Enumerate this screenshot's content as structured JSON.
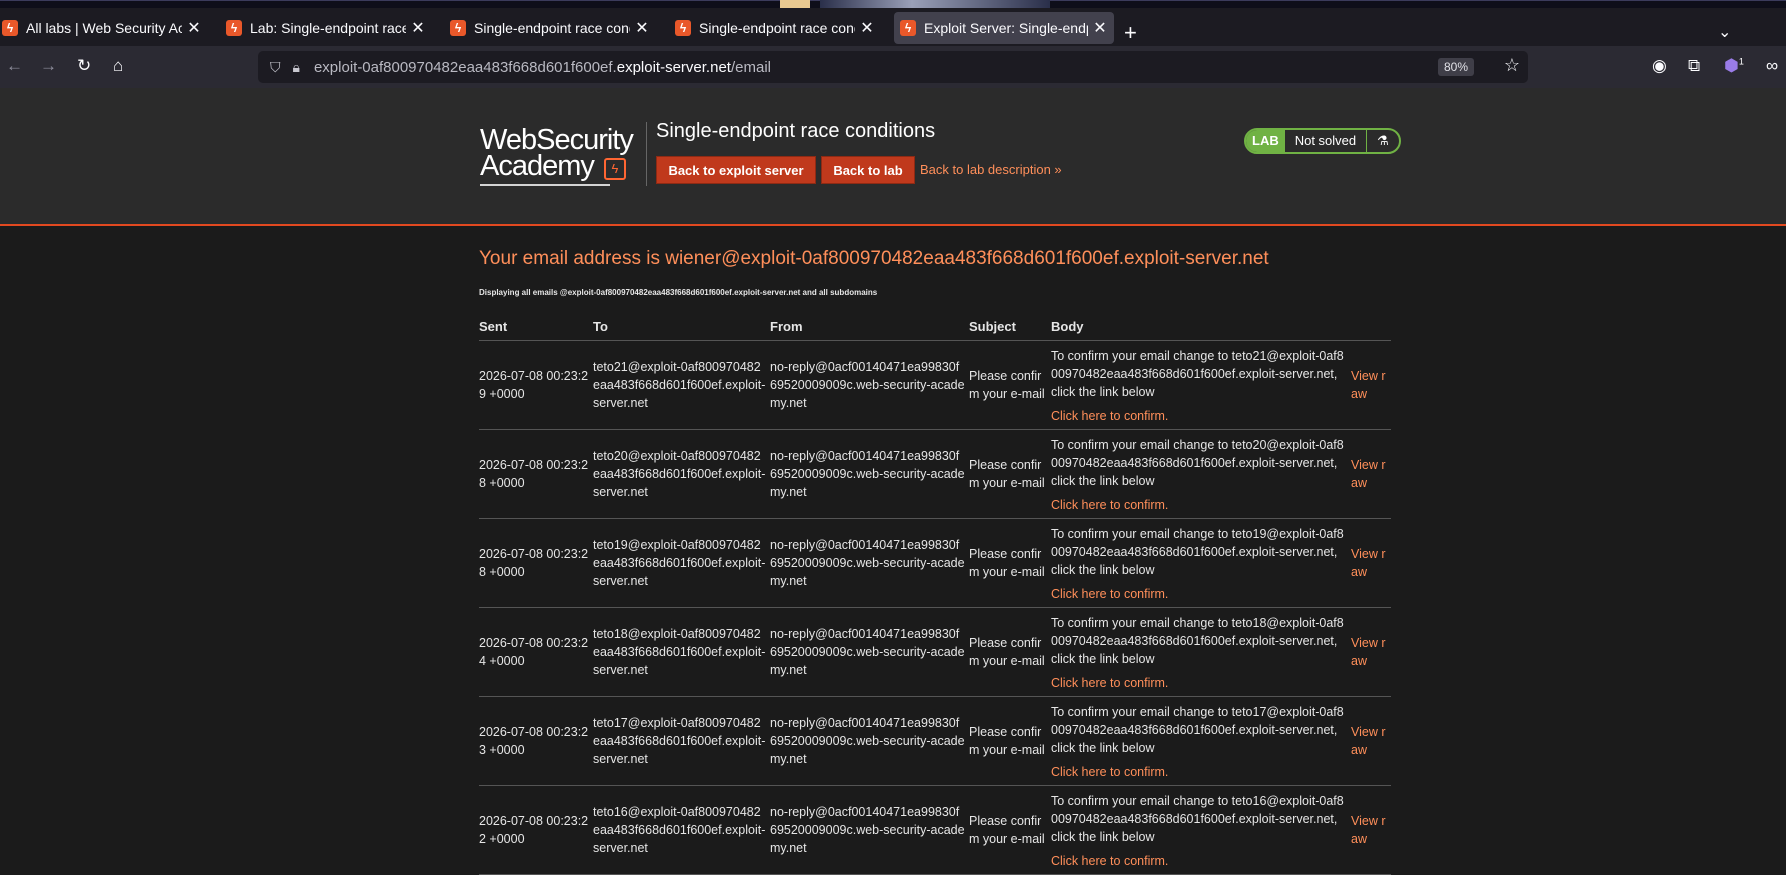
{
  "browser": {
    "tabs": [
      {
        "title": "All labs | Web Security Academy",
        "active": false
      },
      {
        "title": "Lab: Single-endpoint race conditions",
        "active": false
      },
      {
        "title": "Single-endpoint race conditions",
        "active": false
      },
      {
        "title": "Single-endpoint race conditions",
        "active": false
      },
      {
        "title": "Exploit Server: Single-endpoint race conditions",
        "active": true
      }
    ],
    "url_prefix": "exploit-0af800970482eaa483f668d601f600ef.",
    "url_domain": "exploit-server.net",
    "url_path": "/email",
    "zoom": "80%",
    "extension_badge": "1"
  },
  "header": {
    "logo_line1": "WebSecurity",
    "logo_line2": "Academy",
    "lab_title": "Single-endpoint race conditions",
    "btn_exploit": "Back to exploit server",
    "btn_lab": "Back to lab",
    "back_desc": "Back to lab description",
    "status_tag": "LAB",
    "status_text": "Not solved"
  },
  "main": {
    "address_line": "Your email address is wiener@exploit-0af800970482eaa483f668d601f600ef.exploit-server.net",
    "note": "Displaying all emails @exploit-0af800970482eaa483f668d601f600ef.exploit-server.net and all subdomains",
    "columns": [
      "Sent",
      "To",
      "From",
      "Subject",
      "Body",
      ""
    ],
    "rows": [
      {
        "sent": "2026-07-08 00:23:29 +0000",
        "to": "teto21@exploit-0af800970482eaa483f668d601f600ef.exploit-server.net",
        "from": "no-reply@0acf00140471ea99830f69520009009c.web-security-academy.net",
        "subject": "Please confirm your e-mail",
        "body": "To confirm your email change to teto21@exploit-0af800970482eaa483f668d601f600ef.exploit-server.net, click the link below",
        "confirm": "Click here to confirm.",
        "raw": "View raw"
      },
      {
        "sent": "2026-07-08 00:23:28 +0000",
        "to": "teto20@exploit-0af800970482eaa483f668d601f600ef.exploit-server.net",
        "from": "no-reply@0acf00140471ea99830f69520009009c.web-security-academy.net",
        "subject": "Please confirm your e-mail",
        "body": "To confirm your email change to teto20@exploit-0af800970482eaa483f668d601f600ef.exploit-server.net, click the link below",
        "confirm": "Click here to confirm.",
        "raw": "View raw"
      },
      {
        "sent": "2026-07-08 00:23:28 +0000",
        "to": "teto19@exploit-0af800970482eaa483f668d601f600ef.exploit-server.net",
        "from": "no-reply@0acf00140471ea99830f69520009009c.web-security-academy.net",
        "subject": "Please confirm your e-mail",
        "body": "To confirm your email change to teto19@exploit-0af800970482eaa483f668d601f600ef.exploit-server.net, click the link below",
        "confirm": "Click here to confirm.",
        "raw": "View raw"
      },
      {
        "sent": "2026-07-08 00:23:24 +0000",
        "to": "teto18@exploit-0af800970482eaa483f668d601f600ef.exploit-server.net",
        "from": "no-reply@0acf00140471ea99830f69520009009c.web-security-academy.net",
        "subject": "Please confirm your e-mail",
        "body": "To confirm your email change to teto18@exploit-0af800970482eaa483f668d601f600ef.exploit-server.net, click the link below",
        "confirm": "Click here to confirm.",
        "raw": "View raw"
      },
      {
        "sent": "2026-07-08 00:23:23 +0000",
        "to": "teto17@exploit-0af800970482eaa483f668d601f600ef.exploit-server.net",
        "from": "no-reply@0acf00140471ea99830f69520009009c.web-security-academy.net",
        "subject": "Please confirm your e-mail",
        "body": "To confirm your email change to teto17@exploit-0af800970482eaa483f668d601f600ef.exploit-server.net, click the link below",
        "confirm": "Click here to confirm.",
        "raw": "View raw"
      },
      {
        "sent": "2026-07-08 00:23:22 +0000",
        "to": "teto16@exploit-0af800970482eaa483f668d601f600ef.exploit-server.net",
        "from": "no-reply@0acf00140471ea99830f69520009009c.web-security-academy.net",
        "subject": "Please confirm your e-mail",
        "body": "To confirm your email change to teto16@exploit-0af800970482eaa483f668d601f600ef.exploit-server.net, click the link below",
        "confirm": "Click here to confirm.",
        "raw": "View raw"
      }
    ]
  }
}
